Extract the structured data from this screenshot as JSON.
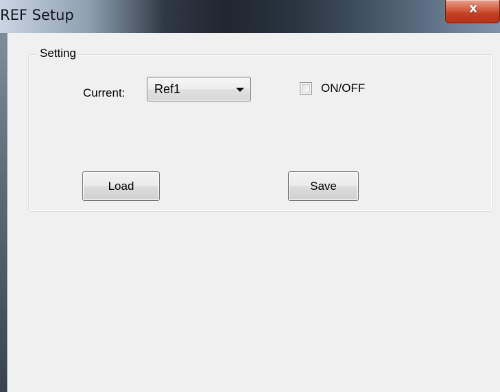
{
  "window": {
    "title": "REF Setup",
    "close_glyph": "x"
  },
  "setting_group": {
    "label": "Setting",
    "current_label": "Current:",
    "current_value": "Ref1",
    "checkbox_label": "ON/OFF",
    "checkbox_checked": false,
    "load_label": "Load",
    "save_label": "Save"
  },
  "icons": {
    "close": "close-icon",
    "dropdown": "chevron-down-icon"
  },
  "colors": {
    "client_background": "#f0f0f0",
    "close_button": "#c2411f",
    "titlebar_dark": "#1f262e"
  }
}
